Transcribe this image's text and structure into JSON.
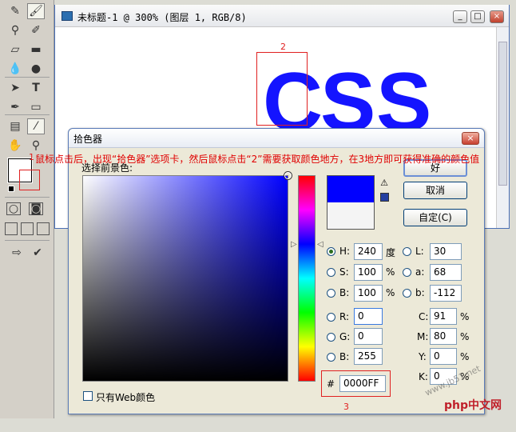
{
  "document": {
    "title": "未标题-1 @ 300% (图层 1, RGB/8)",
    "window_buttons": {
      "minimize": "_",
      "maximize": "□",
      "close": "×"
    },
    "canvas_text": [
      "C",
      "S",
      "S"
    ]
  },
  "annotations": {
    "label_1": "1",
    "label_2": "2",
    "label_3": "3",
    "note": "鼠标点击后，出现“拾色器”选项卡，然后鼠标点击“2”需要获取颜色地方，在3地方即可获得准确的颜色值"
  },
  "dialog": {
    "title": "拾色器",
    "close": "×",
    "prompt": "选择前景色:",
    "buttons": {
      "ok": "好",
      "cancel": "取消",
      "custom": "自定(C)"
    },
    "new_color": "#0000ff",
    "old_color": "#f4f4f4",
    "fields": {
      "H": {
        "label": "H:",
        "value": "240",
        "unit": "度"
      },
      "S": {
        "label": "S:",
        "value": "100",
        "unit": "%"
      },
      "B": {
        "label": "B:",
        "value": "100",
        "unit": "%"
      },
      "R": {
        "label": "R:",
        "value": "0"
      },
      "G": {
        "label": "G:",
        "value": "0"
      },
      "B2": {
        "label": "B:",
        "value": "255"
      },
      "L": {
        "label": "L:",
        "value": "30"
      },
      "a": {
        "label": "a:",
        "value": "68"
      },
      "b": {
        "label": "b:",
        "value": "-112"
      },
      "C": {
        "label": "C:",
        "value": "91",
        "unit": "%"
      },
      "M": {
        "label": "M:",
        "value": "80",
        "unit": "%"
      },
      "Y": {
        "label": "Y:",
        "value": "0",
        "unit": "%"
      },
      "K": {
        "label": "K:",
        "value": "0",
        "unit": "%"
      }
    },
    "hex_label": "#",
    "hex_value": "0000FF",
    "web_only_label": "只有Web颜色",
    "selected_mode": "H"
  },
  "watermark": {
    "site": "www.jb51.net",
    "brand": "php中文网"
  }
}
